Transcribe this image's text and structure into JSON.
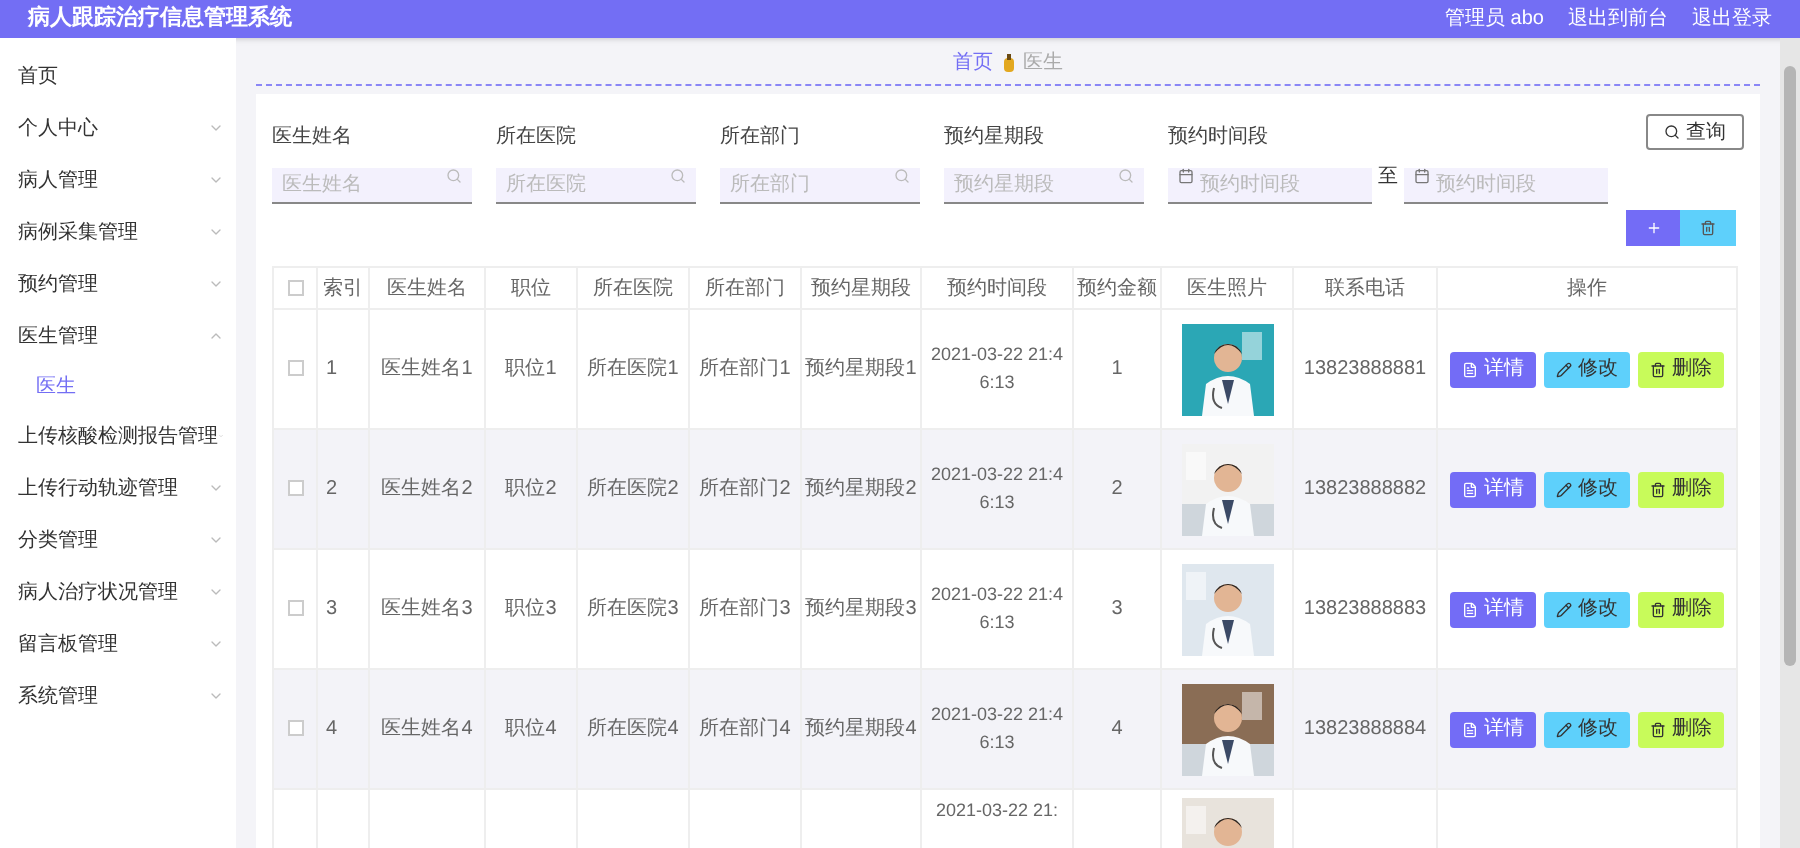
{
  "header": {
    "title": "病人跟踪治疗信息管理系统",
    "user": "管理员 abo",
    "links": [
      "退出到前台",
      "退出登录"
    ]
  },
  "sidebar": {
    "items": [
      {
        "label": "首页",
        "kind": "link"
      },
      {
        "label": "个人中心",
        "kind": "menu",
        "expanded": false
      },
      {
        "label": "病人管理",
        "kind": "menu",
        "expanded": false
      },
      {
        "label": "病例采集管理",
        "kind": "menu",
        "expanded": false
      },
      {
        "label": "预约管理",
        "kind": "menu",
        "expanded": false
      },
      {
        "label": "医生管理",
        "kind": "menu",
        "expanded": true,
        "children": [
          {
            "label": "医生",
            "selected": true
          }
        ]
      },
      {
        "label": "上传核酸检测报告管理",
        "kind": "menu",
        "expanded": false
      },
      {
        "label": "上传行动轨迹管理",
        "kind": "menu",
        "expanded": false
      },
      {
        "label": "分类管理",
        "kind": "menu",
        "expanded": false
      },
      {
        "label": "病人治疗状况管理",
        "kind": "menu",
        "expanded": false
      },
      {
        "label": "留言板管理",
        "kind": "menu",
        "expanded": false
      },
      {
        "label": "系统管理",
        "kind": "menu",
        "expanded": false
      }
    ]
  },
  "breadcrumb": [
    "首页",
    "医生"
  ],
  "filters": [
    {
      "kind": "text",
      "label": "医生姓名",
      "placeholder": "医生姓名"
    },
    {
      "kind": "text",
      "label": "所在医院",
      "placeholder": "所在医院"
    },
    {
      "kind": "text",
      "label": "所在部门",
      "placeholder": "所在部门"
    },
    {
      "kind": "text",
      "label": "预约星期段",
      "placeholder": "预约星期段"
    },
    {
      "kind": "date_range",
      "label": "预约时间段",
      "placeholder": "预约时间段",
      "separator": "至",
      "placeholder_end": "预约时间段"
    }
  ],
  "query_button": "查询",
  "table": {
    "columns": [
      "索引",
      "医生姓名",
      "职位",
      "所在医院",
      "所在部门",
      "预约星期段",
      "预约时间段",
      "预约金额",
      "医生照片",
      "联系电话",
      "操作"
    ],
    "header_checked": false,
    "rows": [
      {
        "checked": false,
        "cells": [
          "1",
          "医生姓名1",
          "职位1",
          "所在医院1",
          "所在部门1",
          "预约星期段1",
          "2021-03-22 21:46:13",
          "1"
        ],
        "phone": "13823888881",
        "actions": [
          "详情",
          "修改",
          "删除"
        ]
      },
      {
        "checked": false,
        "cells": [
          "2",
          "医生姓名2",
          "职位2",
          "所在医院2",
          "所在部门2",
          "预约星期段2",
          "2021-03-22 21:46:13",
          "2"
        ],
        "phone": "13823888882",
        "actions": [
          "详情",
          "修改",
          "删除"
        ]
      },
      {
        "checked": false,
        "cells": [
          "3",
          "医生姓名3",
          "职位3",
          "所在医院3",
          "所在部门3",
          "预约星期段3",
          "2021-03-22 21:46:13",
          "3"
        ],
        "phone": "13823888883",
        "actions": [
          "详情",
          "修改",
          "删除"
        ]
      },
      {
        "checked": false,
        "cells": [
          "4",
          "医生姓名4",
          "职位4",
          "所在医院4",
          "所在部门4",
          "预约星期段4",
          "2021-03-22 21:46:13",
          "4"
        ],
        "phone": "13823888884",
        "actions": [
          "详情",
          "修改",
          "删除"
        ]
      },
      {
        "cells": [
          null,
          null,
          null,
          null,
          null,
          null,
          "2021-03-22 21:",
          null
        ]
      }
    ]
  }
}
